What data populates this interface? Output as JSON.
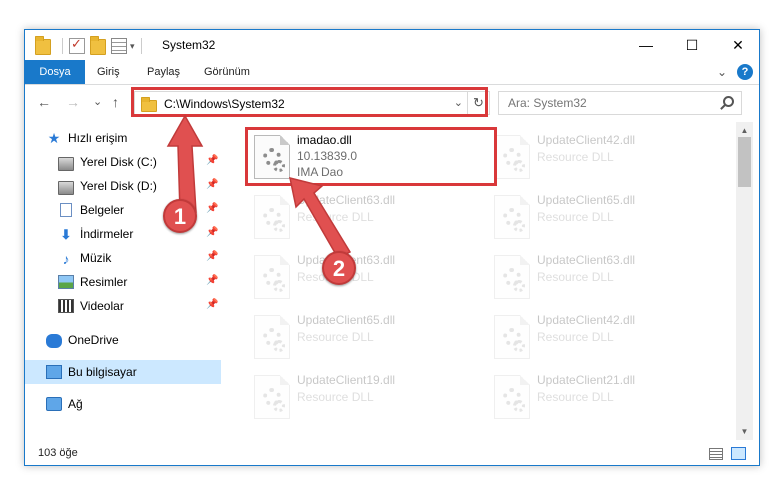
{
  "window": {
    "title": "System32",
    "minimize_glyph": "—",
    "maximize_glyph": "☐",
    "close_glyph": "✕"
  },
  "ribbon": {
    "tabs": [
      "Dosya",
      "Giriş",
      "Paylaş",
      "Görünüm"
    ],
    "expand_glyph": "⌄",
    "help_glyph": "?"
  },
  "nav": {
    "back_glyph": "←",
    "forward_glyph": "→",
    "recent_glyph": "⌄",
    "up_glyph": "↑"
  },
  "address": {
    "path": "C:\\Windows\\System32",
    "dropdown_glyph": "⌄",
    "refresh_glyph": "↻"
  },
  "search": {
    "placeholder": "Ara: System32"
  },
  "sidebar": {
    "items": [
      {
        "label": "Hızlı erişim",
        "icon": "star-icon",
        "pinned": false
      },
      {
        "label": "Yerel Disk (C:)",
        "icon": "disk-icon",
        "pinned": true
      },
      {
        "label": "Yerel Disk (D:)",
        "icon": "disk-icon",
        "pinned": true
      },
      {
        "label": "Belgeler",
        "icon": "documents-icon",
        "pinned": true
      },
      {
        "label": "İndirmeler",
        "icon": "download-icon",
        "pinned": true
      },
      {
        "label": "Müzik",
        "icon": "music-icon",
        "pinned": true
      },
      {
        "label": "Resimler",
        "icon": "pictures-icon",
        "pinned": true
      },
      {
        "label": "Videolar",
        "icon": "videos-icon",
        "pinned": true
      },
      {
        "label": "OneDrive",
        "icon": "cloud-icon",
        "pinned": false
      },
      {
        "label": "Bu bilgisayar",
        "icon": "computer-icon",
        "pinned": false,
        "selected": true
      },
      {
        "label": "Ağ",
        "icon": "network-icon",
        "pinned": false
      }
    ],
    "pin_glyph": "📌"
  },
  "files": [
    {
      "name": "imadao.dll",
      "version": "10.13839.0",
      "company": "IMA Dao",
      "highlighted": true
    },
    {
      "name": "UpdateClient42.dll",
      "description": "Resource DLL"
    },
    {
      "name": "UpdateClient63.dll",
      "description": "Resource DLL"
    },
    {
      "name": "UpdateClient65.dll",
      "description": "Resource DLL"
    },
    {
      "name": "UpdateClient63.dll",
      "description": "Resource DLL"
    },
    {
      "name": "UpdateClient63.dll",
      "description": "Resource DLL"
    },
    {
      "name": "UpdateClient65.dll",
      "description": "Resource DLL"
    },
    {
      "name": "UpdateClient42.dll",
      "description": "Resource DLL"
    },
    {
      "name": "UpdateClient19.dll",
      "description": "Resource DLL"
    },
    {
      "name": "UpdateClient21.dll",
      "description": "Resource DLL"
    }
  ],
  "scrollbar": {
    "up_glyph": "▲",
    "down_glyph": "▼"
  },
  "status": {
    "item_count": "103 öğe"
  },
  "annotations": {
    "step1": "1",
    "step2": "2",
    "highlight_color": "#d9383a"
  },
  "colors": {
    "accent": "#1979ca",
    "selection": "#cce8ff"
  }
}
